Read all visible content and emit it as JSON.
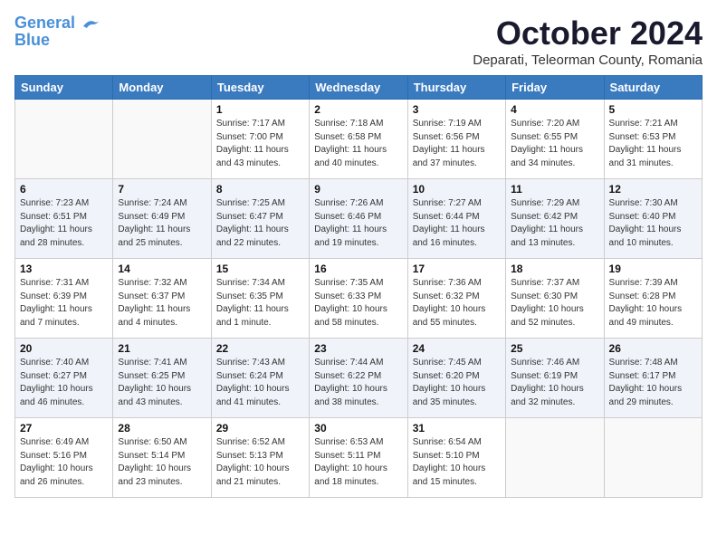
{
  "header": {
    "logo_line1": "General",
    "logo_line2": "Blue",
    "month": "October 2024",
    "location": "Deparati, Teleorman County, Romania"
  },
  "weekdays": [
    "Sunday",
    "Monday",
    "Tuesday",
    "Wednesday",
    "Thursday",
    "Friday",
    "Saturday"
  ],
  "weeks": [
    [
      {
        "day": "",
        "info": ""
      },
      {
        "day": "",
        "info": ""
      },
      {
        "day": "1",
        "info": "Sunrise: 7:17 AM\nSunset: 7:00 PM\nDaylight: 11 hours\nand 43 minutes."
      },
      {
        "day": "2",
        "info": "Sunrise: 7:18 AM\nSunset: 6:58 PM\nDaylight: 11 hours\nand 40 minutes."
      },
      {
        "day": "3",
        "info": "Sunrise: 7:19 AM\nSunset: 6:56 PM\nDaylight: 11 hours\nand 37 minutes."
      },
      {
        "day": "4",
        "info": "Sunrise: 7:20 AM\nSunset: 6:55 PM\nDaylight: 11 hours\nand 34 minutes."
      },
      {
        "day": "5",
        "info": "Sunrise: 7:21 AM\nSunset: 6:53 PM\nDaylight: 11 hours\nand 31 minutes."
      }
    ],
    [
      {
        "day": "6",
        "info": "Sunrise: 7:23 AM\nSunset: 6:51 PM\nDaylight: 11 hours\nand 28 minutes."
      },
      {
        "day": "7",
        "info": "Sunrise: 7:24 AM\nSunset: 6:49 PM\nDaylight: 11 hours\nand 25 minutes."
      },
      {
        "day": "8",
        "info": "Sunrise: 7:25 AM\nSunset: 6:47 PM\nDaylight: 11 hours\nand 22 minutes."
      },
      {
        "day": "9",
        "info": "Sunrise: 7:26 AM\nSunset: 6:46 PM\nDaylight: 11 hours\nand 19 minutes."
      },
      {
        "day": "10",
        "info": "Sunrise: 7:27 AM\nSunset: 6:44 PM\nDaylight: 11 hours\nand 16 minutes."
      },
      {
        "day": "11",
        "info": "Sunrise: 7:29 AM\nSunset: 6:42 PM\nDaylight: 11 hours\nand 13 minutes."
      },
      {
        "day": "12",
        "info": "Sunrise: 7:30 AM\nSunset: 6:40 PM\nDaylight: 11 hours\nand 10 minutes."
      }
    ],
    [
      {
        "day": "13",
        "info": "Sunrise: 7:31 AM\nSunset: 6:39 PM\nDaylight: 11 hours\nand 7 minutes."
      },
      {
        "day": "14",
        "info": "Sunrise: 7:32 AM\nSunset: 6:37 PM\nDaylight: 11 hours\nand 4 minutes."
      },
      {
        "day": "15",
        "info": "Sunrise: 7:34 AM\nSunset: 6:35 PM\nDaylight: 11 hours\nand 1 minute."
      },
      {
        "day": "16",
        "info": "Sunrise: 7:35 AM\nSunset: 6:33 PM\nDaylight: 10 hours\nand 58 minutes."
      },
      {
        "day": "17",
        "info": "Sunrise: 7:36 AM\nSunset: 6:32 PM\nDaylight: 10 hours\nand 55 minutes."
      },
      {
        "day": "18",
        "info": "Sunrise: 7:37 AM\nSunset: 6:30 PM\nDaylight: 10 hours\nand 52 minutes."
      },
      {
        "day": "19",
        "info": "Sunrise: 7:39 AM\nSunset: 6:28 PM\nDaylight: 10 hours\nand 49 minutes."
      }
    ],
    [
      {
        "day": "20",
        "info": "Sunrise: 7:40 AM\nSunset: 6:27 PM\nDaylight: 10 hours\nand 46 minutes."
      },
      {
        "day": "21",
        "info": "Sunrise: 7:41 AM\nSunset: 6:25 PM\nDaylight: 10 hours\nand 43 minutes."
      },
      {
        "day": "22",
        "info": "Sunrise: 7:43 AM\nSunset: 6:24 PM\nDaylight: 10 hours\nand 41 minutes."
      },
      {
        "day": "23",
        "info": "Sunrise: 7:44 AM\nSunset: 6:22 PM\nDaylight: 10 hours\nand 38 minutes."
      },
      {
        "day": "24",
        "info": "Sunrise: 7:45 AM\nSunset: 6:20 PM\nDaylight: 10 hours\nand 35 minutes."
      },
      {
        "day": "25",
        "info": "Sunrise: 7:46 AM\nSunset: 6:19 PM\nDaylight: 10 hours\nand 32 minutes."
      },
      {
        "day": "26",
        "info": "Sunrise: 7:48 AM\nSunset: 6:17 PM\nDaylight: 10 hours\nand 29 minutes."
      }
    ],
    [
      {
        "day": "27",
        "info": "Sunrise: 6:49 AM\nSunset: 5:16 PM\nDaylight: 10 hours\nand 26 minutes."
      },
      {
        "day": "28",
        "info": "Sunrise: 6:50 AM\nSunset: 5:14 PM\nDaylight: 10 hours\nand 23 minutes."
      },
      {
        "day": "29",
        "info": "Sunrise: 6:52 AM\nSunset: 5:13 PM\nDaylight: 10 hours\nand 21 minutes."
      },
      {
        "day": "30",
        "info": "Sunrise: 6:53 AM\nSunset: 5:11 PM\nDaylight: 10 hours\nand 18 minutes."
      },
      {
        "day": "31",
        "info": "Sunrise: 6:54 AM\nSunset: 5:10 PM\nDaylight: 10 hours\nand 15 minutes."
      },
      {
        "day": "",
        "info": ""
      },
      {
        "day": "",
        "info": ""
      }
    ]
  ]
}
